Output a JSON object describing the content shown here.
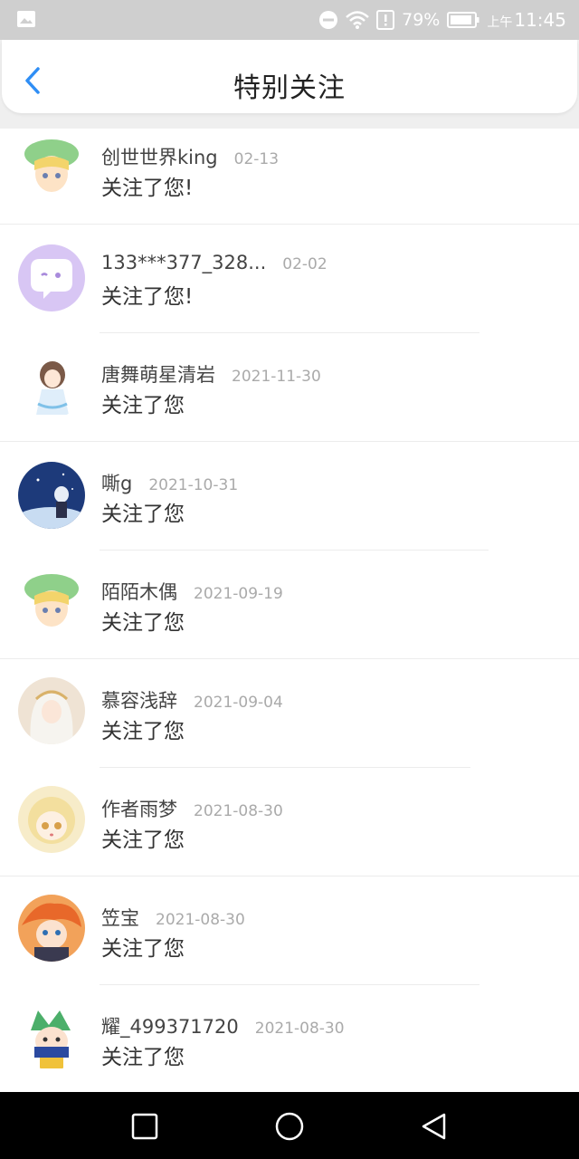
{
  "status_bar": {
    "battery_percent": "79%",
    "time_prefix": "上午",
    "time": "11:45",
    "icons": [
      "gallery-icon",
      "do-not-disturb-icon",
      "wifi-icon",
      "alert-icon",
      "battery-icon"
    ]
  },
  "header": {
    "back_icon": "chevron-left-icon",
    "title": "特别关注",
    "accent": "#2f8ef5"
  },
  "list": {
    "items": [
      {
        "name": "创世世界king",
        "date": "02-13",
        "message": "关注了您!"
      },
      {
        "name": "133***377_328...",
        "date": "02-02",
        "message": "关注了您!"
      },
      {
        "name": "唐舞萌星清岩",
        "date": "2021-11-30",
        "message": "关注了您"
      },
      {
        "name": "嘶g",
        "date": "2021-10-31",
        "message": "关注了您"
      },
      {
        "name": "陌陌木偶",
        "date": "2021-09-19",
        "message": "关注了您"
      },
      {
        "name": "慕容浅辞",
        "date": "2021-09-04",
        "message": "关注了您"
      },
      {
        "name": "作者雨梦",
        "date": "2021-08-30",
        "message": "关注了您"
      },
      {
        "name": "笠宝",
        "date": "2021-08-30",
        "message": "关注了您"
      },
      {
        "name": "耀_499371720",
        "date": "2021-08-30",
        "message": "关注了您"
      }
    ]
  },
  "nav_bar": {
    "icons": [
      "recent-apps-icon",
      "home-icon",
      "back-triangle-icon"
    ]
  }
}
